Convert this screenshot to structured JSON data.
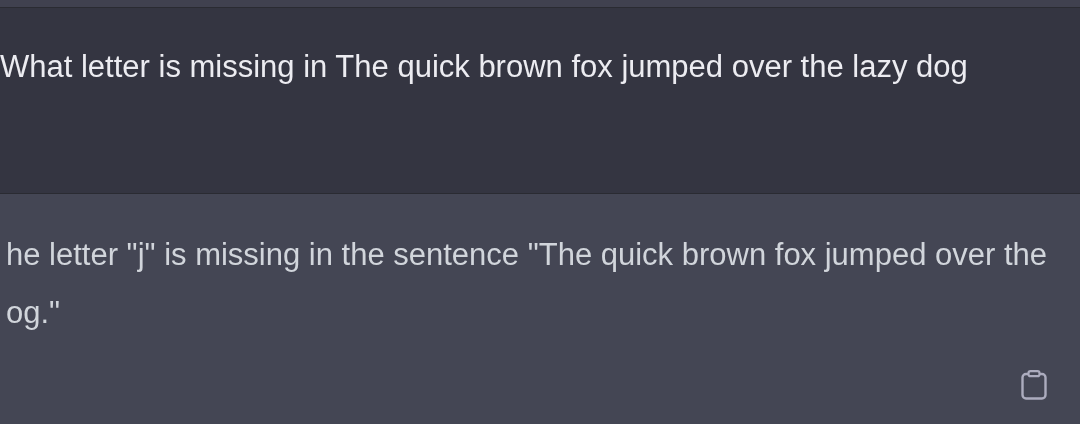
{
  "messages": [
    {
      "kind": "user",
      "text": "What letter is missing in The quick brown fox jumped over the lazy dog"
    },
    {
      "kind": "assistant",
      "lines": [
        "he letter \"j\" is missing in the sentence \"The quick brown fox jumped over the",
        "og.\""
      ]
    }
  ]
}
